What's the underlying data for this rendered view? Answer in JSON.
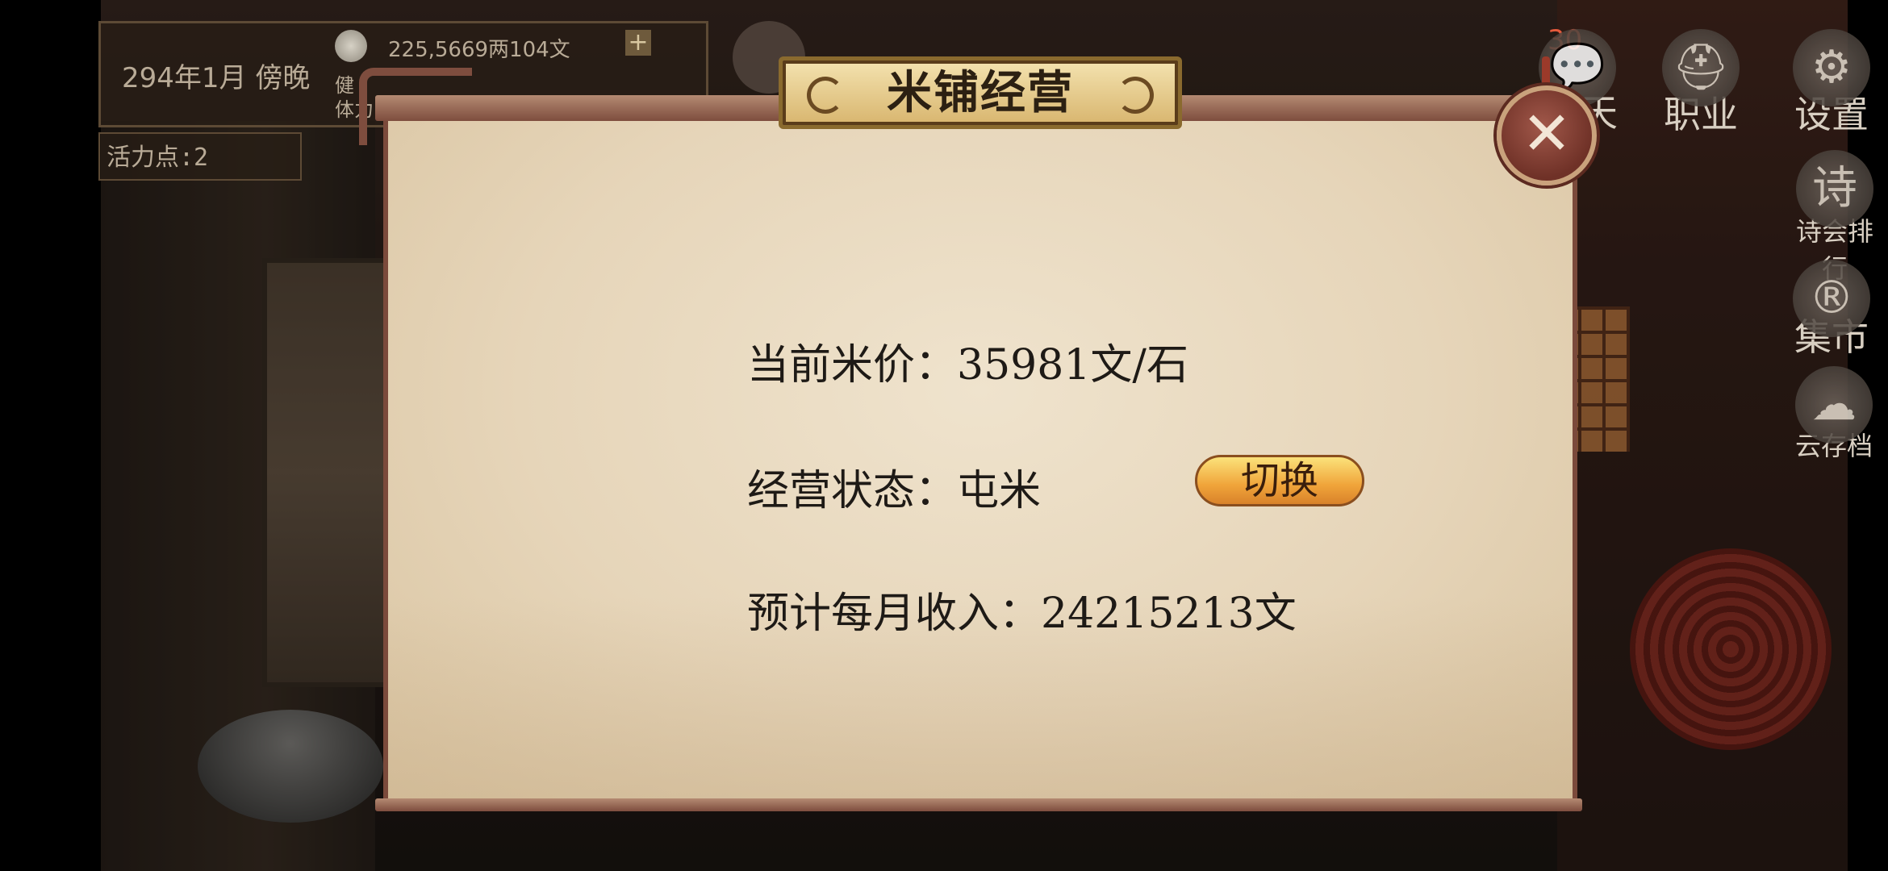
{
  "hud": {
    "date": "294年1月  傍晚",
    "money": "225,5669两104文",
    "stat_line1": "健",
    "stat_line2": "体力",
    "vigor": "活力点:2",
    "notification_count": "30"
  },
  "side_menu": [
    {
      "label": "天",
      "icon": "chat-icon"
    },
    {
      "label": "职业",
      "icon": "helmet-icon"
    },
    {
      "label": "设置",
      "icon": "gear-icon"
    },
    {
      "label": "诗会排行",
      "icon": "poem-icon",
      "glyph": "诗"
    },
    {
      "label": "集市",
      "icon": "market-icon",
      "glyph": "®"
    },
    {
      "label": "云存档",
      "icon": "cloud-save-icon",
      "glyph": "☁"
    }
  ],
  "modal": {
    "title": "米铺经营",
    "close_glyph": "✕",
    "rice_price_label": "当前米价：",
    "rice_price_value": "35981文/石",
    "status_label": "经营状态：",
    "status_value": "屯米",
    "toggle_label": "切换",
    "income_label": "预计每月收入：",
    "income_value": "24215213文"
  }
}
